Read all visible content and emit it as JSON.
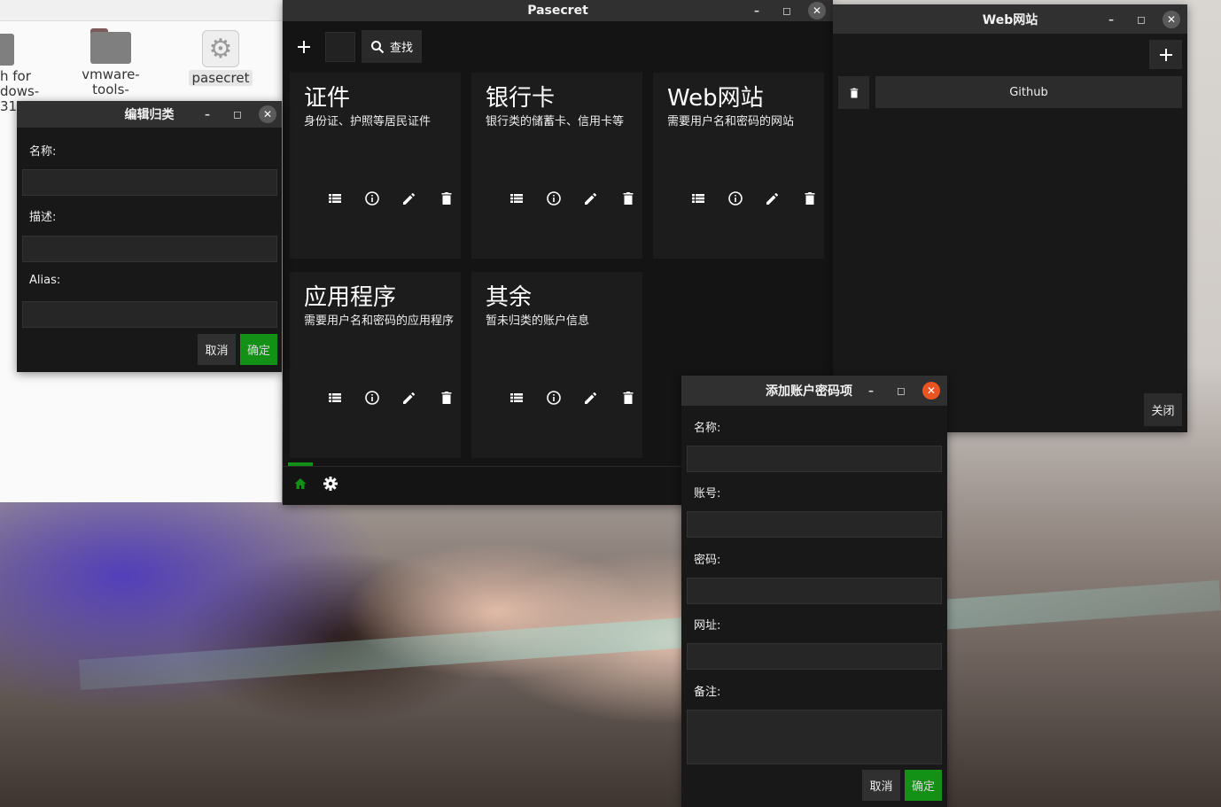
{
  "desktop": {
    "file_manager": {
      "items": [
        {
          "label_lines": [
            "h for",
            "dows-",
            "31-"
          ]
        },
        {
          "label_lines": [
            "vmware-",
            "tools-"
          ]
        },
        {
          "label": "pasecret"
        }
      ]
    }
  },
  "main_window": {
    "title": "Pasecret",
    "toolbar": {
      "add_icon": "plus-icon",
      "search_label": "查找"
    },
    "categories": [
      {
        "title": "证件",
        "desc": "身份证、护照等居民证件"
      },
      {
        "title": "银行卡",
        "desc": "银行类的储蓄卡、信用卡等"
      },
      {
        "title": "Web网站",
        "desc": "需要用户名和密码的网站"
      },
      {
        "title": "应用程序",
        "desc": "需要用户名和密码的应用程序"
      },
      {
        "title": "其余",
        "desc": "暂未归类的账户信息"
      }
    ],
    "card_action_icons": [
      "list-icon",
      "info-icon",
      "edit-icon",
      "delete-icon"
    ],
    "bottom_nav": {
      "home_icon": "home-icon",
      "settings_icon": "settings-gear-icon"
    }
  },
  "edit_category_window": {
    "title": "编辑归类",
    "fields": {
      "name_label": "名称:",
      "desc_label": "描述:",
      "alias_label": "Alias:"
    },
    "buttons": {
      "cancel": "取消",
      "ok": "确定"
    }
  },
  "web_window": {
    "title": "Web网站",
    "entries": [
      {
        "name": "Github"
      }
    ],
    "buttons": {
      "close": "关闭"
    }
  },
  "add_entry_window": {
    "title": "添加账户密码项",
    "fields": {
      "name_label": "名称:",
      "account_label": "账号:",
      "password_label": "密码:",
      "url_label": "网址:",
      "note_label": "备注:"
    },
    "buttons": {
      "cancel": "取消",
      "ok": "确定"
    }
  },
  "colors": {
    "accent_green": "#139116",
    "close_active": "#e95420",
    "window_bg": "#181818",
    "titlebar_bg": "#303030"
  }
}
